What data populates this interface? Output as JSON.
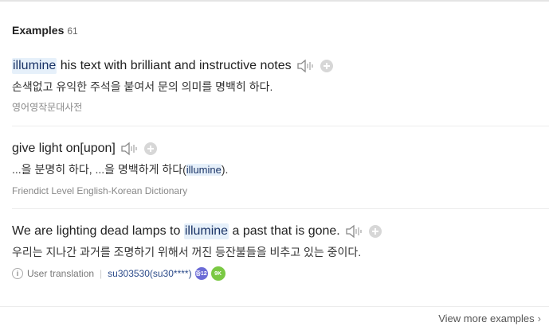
{
  "section": {
    "title": "Examples",
    "count": "61"
  },
  "examples": [
    {
      "pre": "",
      "highlight": "illumine",
      "post": " his text with brilliant and instructive notes",
      "translation": "손색없고 유익한 주석을 붙여서 문의 의미를 명백히 하다.",
      "source": "영어영작문대사전"
    },
    {
      "pre": "give light on[upon]",
      "translation_pre": "...을 분명히 하다, ...을 명백하게 하다(",
      "translation_highlight": "illumine",
      "translation_post": ").",
      "source": "Friendict Level English-Korean Dictionary"
    },
    {
      "pre": "We are lighting dead lamps to ",
      "highlight": "illumine",
      "post": " a past that is gone.",
      "translation": "우리는 지나간 과거를 조명하기 위해서 꺼진 등잔불들을 비추고 있는 중이다.",
      "user_label": "User translation",
      "user_name": "su303530(su30****)",
      "badge_level": "중12",
      "badge_points": "9K"
    }
  ],
  "footer": {
    "view_more": "View more examples"
  },
  "icons": {
    "speaker": "speaker-icon",
    "add": "plus-icon",
    "info": "info-icon",
    "chevron": "chevron-right-icon"
  }
}
